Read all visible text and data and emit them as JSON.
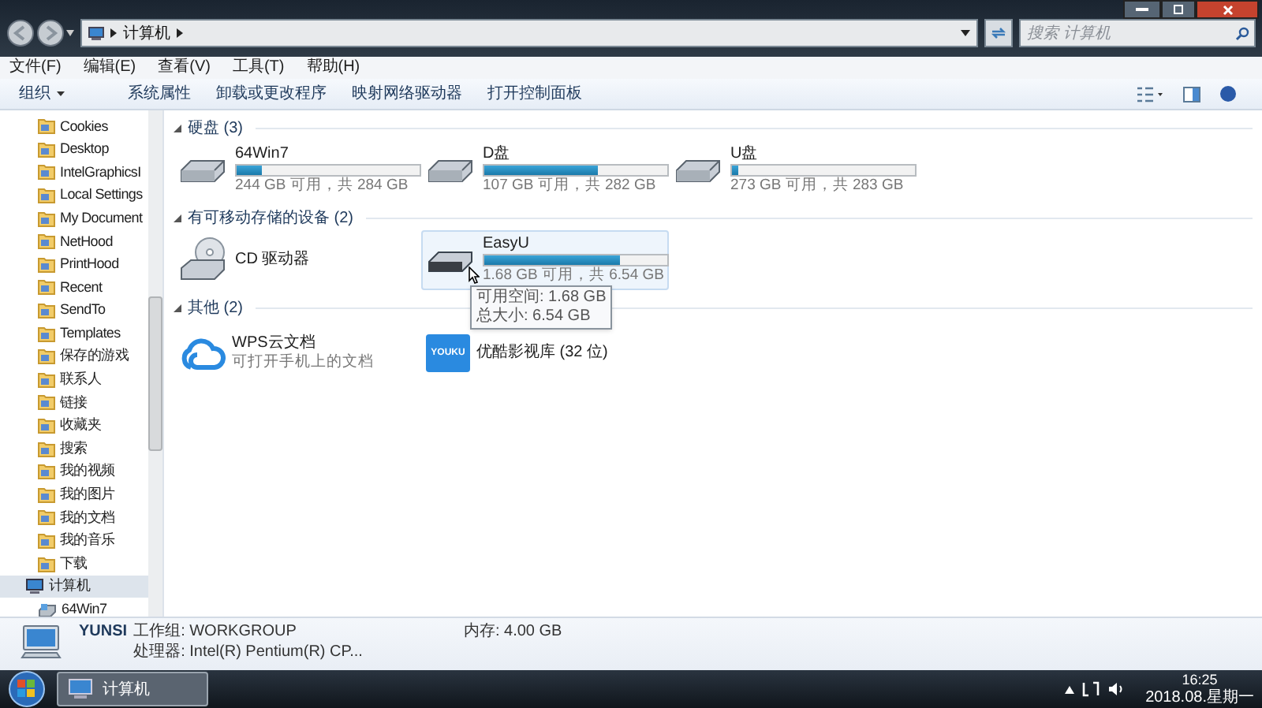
{
  "window": {
    "address_path": [
      "计算机"
    ],
    "search": {
      "placeholder": "搜索 计算机"
    }
  },
  "menu": [
    "文件(F)",
    "编辑(E)",
    "查看(V)",
    "工具(T)",
    "帮助(H)"
  ],
  "toolbar": [
    {
      "label": "组织",
      "kind": "dropdown"
    },
    {
      "label": "系统属性",
      "kind": "button"
    },
    {
      "label": "卸载或更改程序",
      "kind": "button"
    },
    {
      "label": "映射网络驱动器",
      "kind": "button"
    },
    {
      "label": "打开控制面板",
      "kind": "button"
    }
  ],
  "sidebar": {
    "items": [
      {
        "label": "Cookies",
        "kind": "folder",
        "selected": false
      },
      {
        "label": "Desktop",
        "kind": "folder",
        "selected": false
      },
      {
        "label": "IntelGraphicsI",
        "kind": "folder",
        "selected": false
      },
      {
        "label": "Local Settings",
        "kind": "folder",
        "selected": false
      },
      {
        "label": "My Document",
        "kind": "folder",
        "selected": false
      },
      {
        "label": "NetHood",
        "kind": "folder",
        "selected": false
      },
      {
        "label": "PrintHood",
        "kind": "folder",
        "selected": false
      },
      {
        "label": "Recent",
        "kind": "folder",
        "selected": false
      },
      {
        "label": "SendTo",
        "kind": "folder",
        "selected": false
      },
      {
        "label": "Templates",
        "kind": "folder",
        "selected": false
      },
      {
        "label": "保存的游戏",
        "kind": "folder",
        "selected": false
      },
      {
        "label": "联系人",
        "kind": "folder",
        "selected": false
      },
      {
        "label": "链接",
        "kind": "folder",
        "selected": false
      },
      {
        "label": "收藏夹",
        "kind": "folder",
        "selected": false
      },
      {
        "label": "搜索",
        "kind": "folder",
        "selected": false
      },
      {
        "label": "我的视频",
        "kind": "folder",
        "selected": false
      },
      {
        "label": "我的图片",
        "kind": "folder",
        "selected": false
      },
      {
        "label": "我的文档",
        "kind": "folder",
        "selected": false
      },
      {
        "label": "我的音乐",
        "kind": "folder",
        "selected": false
      },
      {
        "label": "下载",
        "kind": "folder",
        "selected": false
      },
      {
        "label": "计算机",
        "kind": "computer",
        "selected": true
      },
      {
        "label": "64Win7",
        "kind": "drive",
        "selected": false
      }
    ]
  },
  "groups": [
    {
      "title": "硬盘 (3)",
      "expanded": true,
      "items": [
        {
          "kind": "drive",
          "name": "64Win7",
          "level": 0.14,
          "info": "244 GB 可用，共 284 GB",
          "selected": false
        },
        {
          "kind": "drive",
          "name": "D盘",
          "level": 0.62,
          "info": "107 GB 可用，共 282 GB",
          "selected": false
        },
        {
          "kind": "drive",
          "name": "U盘",
          "level": 0.035,
          "info": "273 GB 可用，共 283 GB",
          "selected": false
        }
      ]
    },
    {
      "title": "有可移动存储的设备 (2)",
      "expanded": true,
      "items": [
        {
          "kind": "cd",
          "name": "CD 驱动器",
          "selected": false
        },
        {
          "kind": "usb",
          "name": "EasyU",
          "level": 0.74,
          "info": "1.68 GB 可用，共 6.54 GB",
          "selected": true,
          "tooltip": [
            "可用空间: 1.68 GB",
            "总大小: 6.54 GB"
          ]
        }
      ]
    },
    {
      "title": "其他 (2)",
      "expanded": true,
      "items": [
        {
          "kind": "cloud",
          "name": "WPS云文档",
          "info": "可打开手机上的文档",
          "selected": false
        },
        {
          "kind": "youku",
          "name": "优酷影视库 (32 位)",
          "logo": "YOUKU",
          "selected": false
        }
      ]
    }
  ],
  "details": {
    "name": "YUNSI",
    "fields": [
      "工作组: WORKGROUP",
      "内存: 4.00 GB",
      "处理器: Intel(R) Pentium(R) CP..."
    ]
  },
  "taskbar": {
    "tasks": [
      {
        "label": "计算机",
        "selected": true
      }
    ],
    "time": "16:25",
    "date": "2018.08.星期一"
  }
}
